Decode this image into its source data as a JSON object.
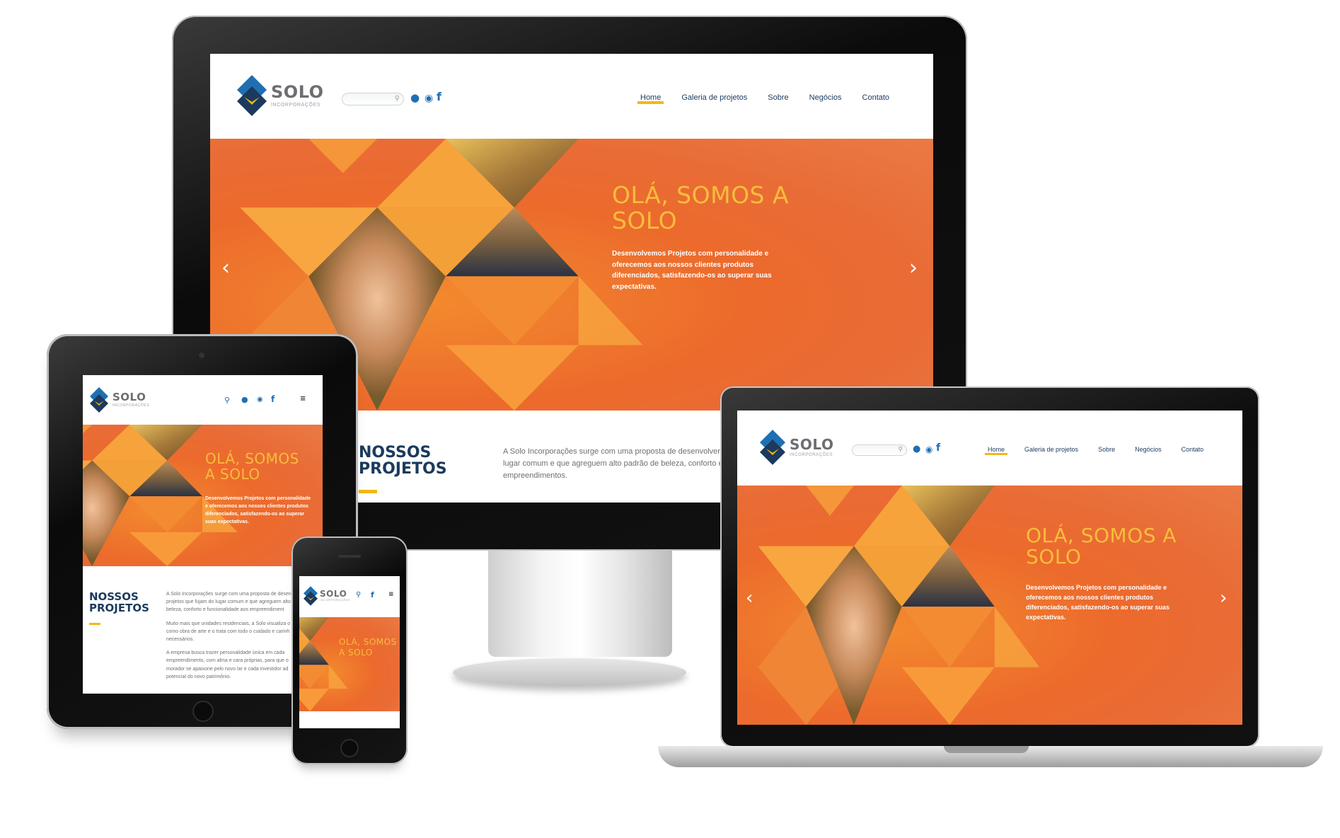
{
  "brand": {
    "name": "SOLO",
    "subtitle": "INCORPORAÇÕES",
    "colors": {
      "blue": "#1f6fb2",
      "navy": "#1b3a5e",
      "orange": "#ec6a2c",
      "yellow": "#f2b817",
      "title": "#f7bd3c"
    }
  },
  "nav": {
    "items": [
      "Home",
      "Galeria de projetos",
      "Sobre",
      "Negócios",
      "Contato"
    ],
    "active": "Home"
  },
  "icons": {
    "search": "search-icon",
    "user": "user-icon",
    "lock": "lock-icon",
    "facebook": "facebook-icon",
    "menu": "menu-icon",
    "prev": "chevron-left-icon",
    "next": "chevron-right-icon"
  },
  "hero": {
    "title_line1": "OLÁ, SOMOS A",
    "title_line2": "SOLO",
    "tablet_title_line1": "OLÁ, SOMOS",
    "tablet_title_line2": "A SOLO",
    "text_line1": "Desenvolvemos Projetos com personalidade e",
    "text_line2": "oferecemos aos nossos clientes produtos",
    "text_line3": "diferenciados, satisfazendo-os ao superar suas",
    "text_line4": "expectativas.",
    "tablet_text_line1": "Desenvolvemos Projetos com personalidade",
    "tablet_text_line2": "e oferecemos aos nossos clientes produtos",
    "tablet_text_line3": "diferenciados, satisfazendo-os ao superar",
    "tablet_text_line4": "suas expectativas."
  },
  "projects": {
    "title_line1": "NOSSOS",
    "title_line2": "PROJETOS",
    "desktop_p1": "A Solo Incorporações surge com uma proposta de desenvolver proj",
    "desktop_p2": "lugar comum e que agreguem alto padrão de beleza, conforto e fun",
    "desktop_p3": "empreendimentos.",
    "tablet_p1": "A Solo Incorporações surge com uma proposta de desen",
    "tablet_p2": "projetos que fujam do lugar comum e que agreguem alto",
    "tablet_p3": "beleza, conforto e funcionalidade aos empreendiment",
    "tablet_p4": "Muito mais que unidades residenciais, a Solo visualiza o",
    "tablet_p5": "como obra de arte e o trata com todo o cuidado e carinh",
    "tablet_p6": "necessários.",
    "tablet_p7": "A empresa busca trazer personalidade única em cada",
    "tablet_p8": "empreendimento, com alma e cara próprias, para que o",
    "tablet_p9": "morador se apaixone pelo novo lar e cada investidor ad",
    "tablet_p10": "potencial do novo patrimônio."
  }
}
